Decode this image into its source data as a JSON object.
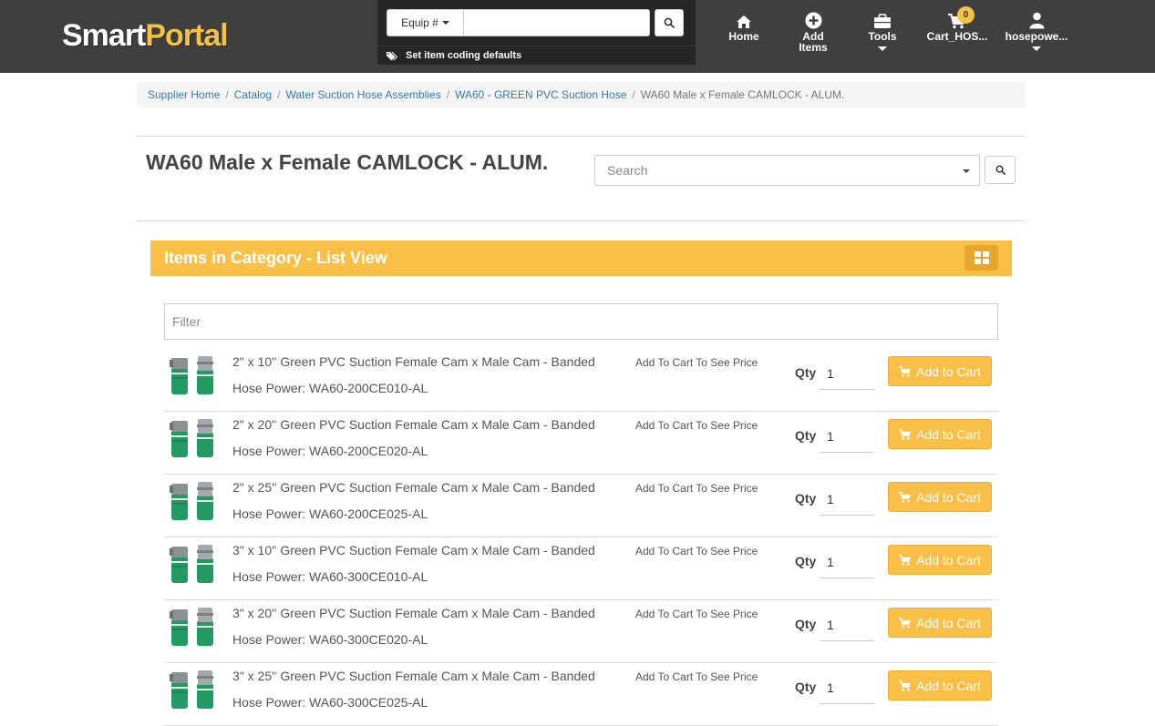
{
  "brand": {
    "part1": "Smart",
    "part2": "Portal",
    "accent_color": "#f7c141"
  },
  "equip_search": {
    "dropdown_label": "Equip #",
    "input_value": "",
    "coding_defaults": "Set item coding defaults"
  },
  "nav": {
    "home": "Home",
    "add_items_line1": "Add",
    "add_items_line2": "Items",
    "tools": "Tools",
    "cart": "Cart_HOS...",
    "cart_count": "0",
    "user": "hosepowe..."
  },
  "breadcrumb": {
    "items": [
      "Supplier Home",
      "Catalog",
      "Water Suction Hose Assemblies",
      "WA60 - GREEN PVC Suction Hose"
    ],
    "separator": "/",
    "current": "WA60 Male x Female CAMLOCK - ALUM."
  },
  "page": {
    "title": "WA60 Male x Female CAMLOCK - ALUM.",
    "search_placeholder": "Search"
  },
  "panel": {
    "title": "Items in Category - List View",
    "filter_placeholder": "Filter",
    "header_color": "#f9bf47"
  },
  "labels": {
    "qty": "Qty",
    "add_to_cart": "Add to Cart",
    "price_note": "Add To Cart To See Price"
  },
  "items": [
    {
      "title": "2\" x 10'' Green PVC Suction Female Cam x Male Cam - Banded",
      "sku": "Hose Power: WA60-200CE010-AL",
      "qty": "1"
    },
    {
      "title": "2\" x 20'' Green PVC Suction Female Cam x Male Cam - Banded",
      "sku": "Hose Power: WA60-200CE020-AL",
      "qty": "1"
    },
    {
      "title": "2\" x 25'' Green PVC Suction Female Cam x Male Cam - Banded",
      "sku": "Hose Power: WA60-200CE025-AL",
      "qty": "1"
    },
    {
      "title": "3\" x 10'' Green PVC Suction Female Cam x Male Cam - Banded",
      "sku": "Hose Power: WA60-300CE010-AL",
      "qty": "1"
    },
    {
      "title": "3\" x 20'' Green PVC Suction Female Cam x Male Cam - Banded",
      "sku": "Hose Power: WA60-300CE020-AL",
      "qty": "1"
    },
    {
      "title": "3\" x 25'' Green PVC Suction Female Cam x Male Cam - Banded",
      "sku": "Hose Power: WA60-300CE025-AL",
      "qty": "1"
    }
  ],
  "icons": {
    "equip_search": "search-icon",
    "coding_defaults": "tags-icon",
    "home": "home-icon",
    "add_items": "plus-circle-icon",
    "tools": "briefcase-icon",
    "cart": "cart-icon",
    "user": "user-icon",
    "category_search": "search-icon",
    "grid_view": "grid-icon",
    "add_to_cart": "cart-icon"
  }
}
